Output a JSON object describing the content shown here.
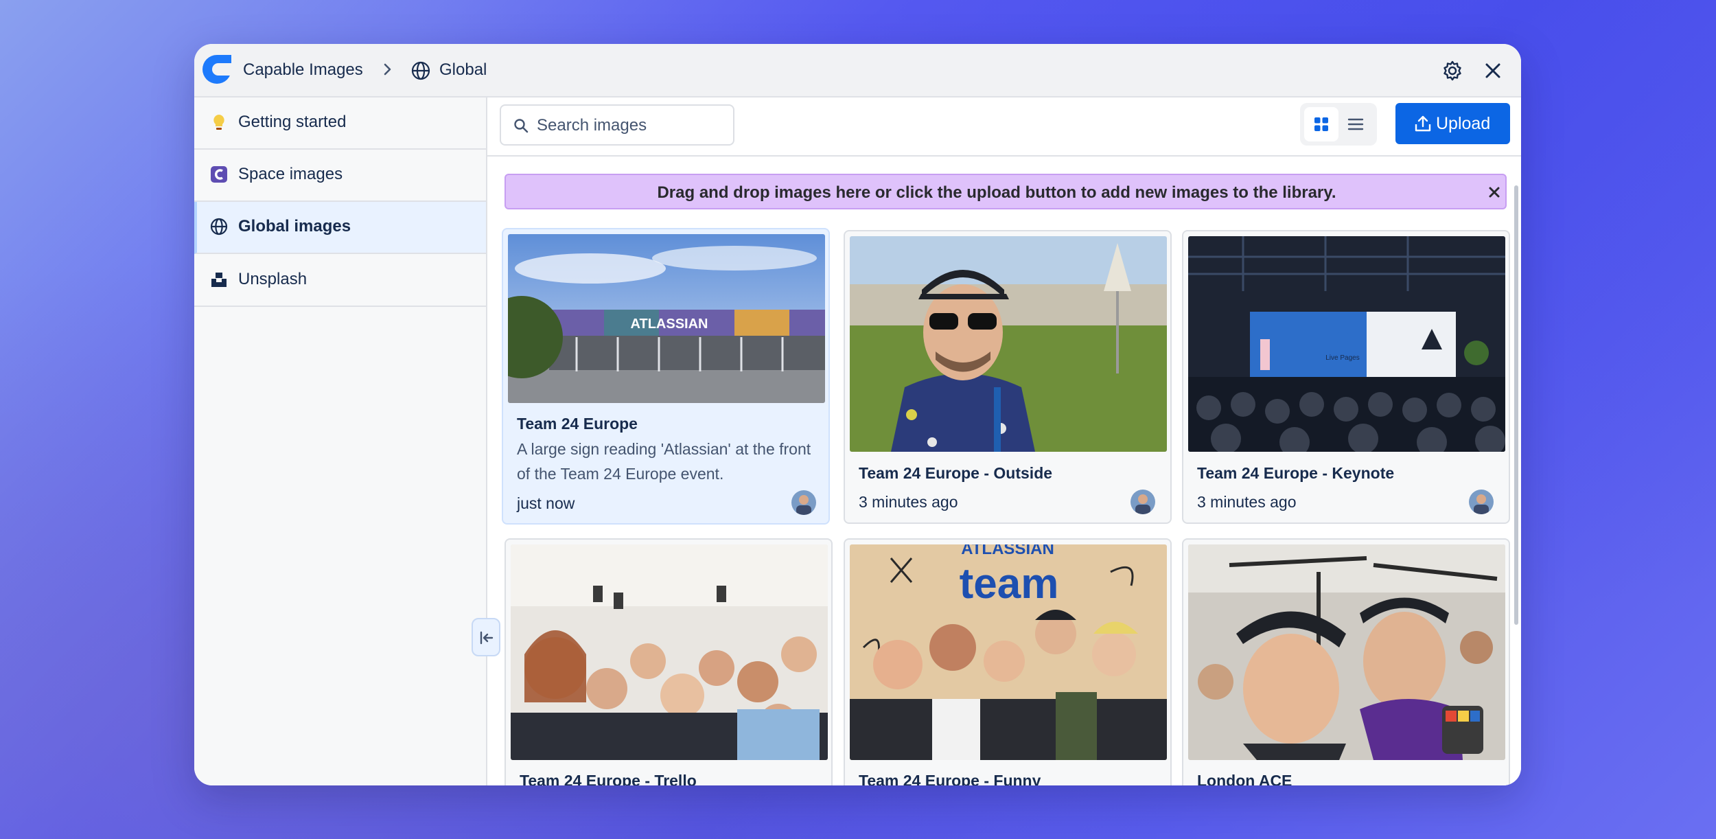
{
  "window": {
    "app_name": "Capable Images",
    "space_name": "Global",
    "icons": {
      "logo": "capable-logo-icon",
      "breadcrumb": "chevron-right-icon",
      "space": "globe-icon",
      "settings": "gear-icon",
      "close": "close-icon"
    }
  },
  "sidebar": {
    "items": [
      {
        "label": "Getting started",
        "icon": "lightbulb-icon",
        "active": false
      },
      {
        "label": "Space images",
        "icon": "space-icon",
        "active": false
      },
      {
        "label": "Global images",
        "icon": "globe-icon",
        "active": true
      },
      {
        "label": "Unsplash",
        "icon": "unsplash-icon",
        "active": false
      }
    ],
    "collapse_icon": "collapse-left-icon"
  },
  "toolbar": {
    "search_placeholder": "Search images",
    "search_value": "",
    "view_mode": "grid",
    "upload_label": "Upload"
  },
  "banner": {
    "text": "Drag and drop images here or click the upload button to add new images to the library."
  },
  "images": [
    {
      "title": "Team 24 Europe",
      "description": "A large sign reading 'Atlassian' at the front of the Team 24 Europe event.",
      "time": "just now",
      "selected": true
    },
    {
      "title": "Team 24 Europe - Outside",
      "description": "",
      "time": "3 minutes ago",
      "selected": false
    },
    {
      "title": "Team 24 Europe - Keynote",
      "description": "",
      "time": "3 minutes ago",
      "selected": false
    },
    {
      "title": "Team 24 Europe - Trello",
      "description": "",
      "time": "",
      "selected": false
    },
    {
      "title": "Team 24 Europe - Funny",
      "description": "",
      "time": "",
      "selected": false
    },
    {
      "title": "London ACE",
      "description": "",
      "time": "",
      "selected": false
    }
  ],
  "photo_text": {
    "building_sign": "ATLASSIAN",
    "stage_screen": "Live Pages",
    "wall_brand": "ATLASSIAN",
    "wall_word": "team"
  },
  "colors": {
    "primary": "#0c66e4",
    "banner_bg": "#dfc2fb",
    "selected_bg": "#e9f2ff",
    "logo": "#1d7afc"
  }
}
